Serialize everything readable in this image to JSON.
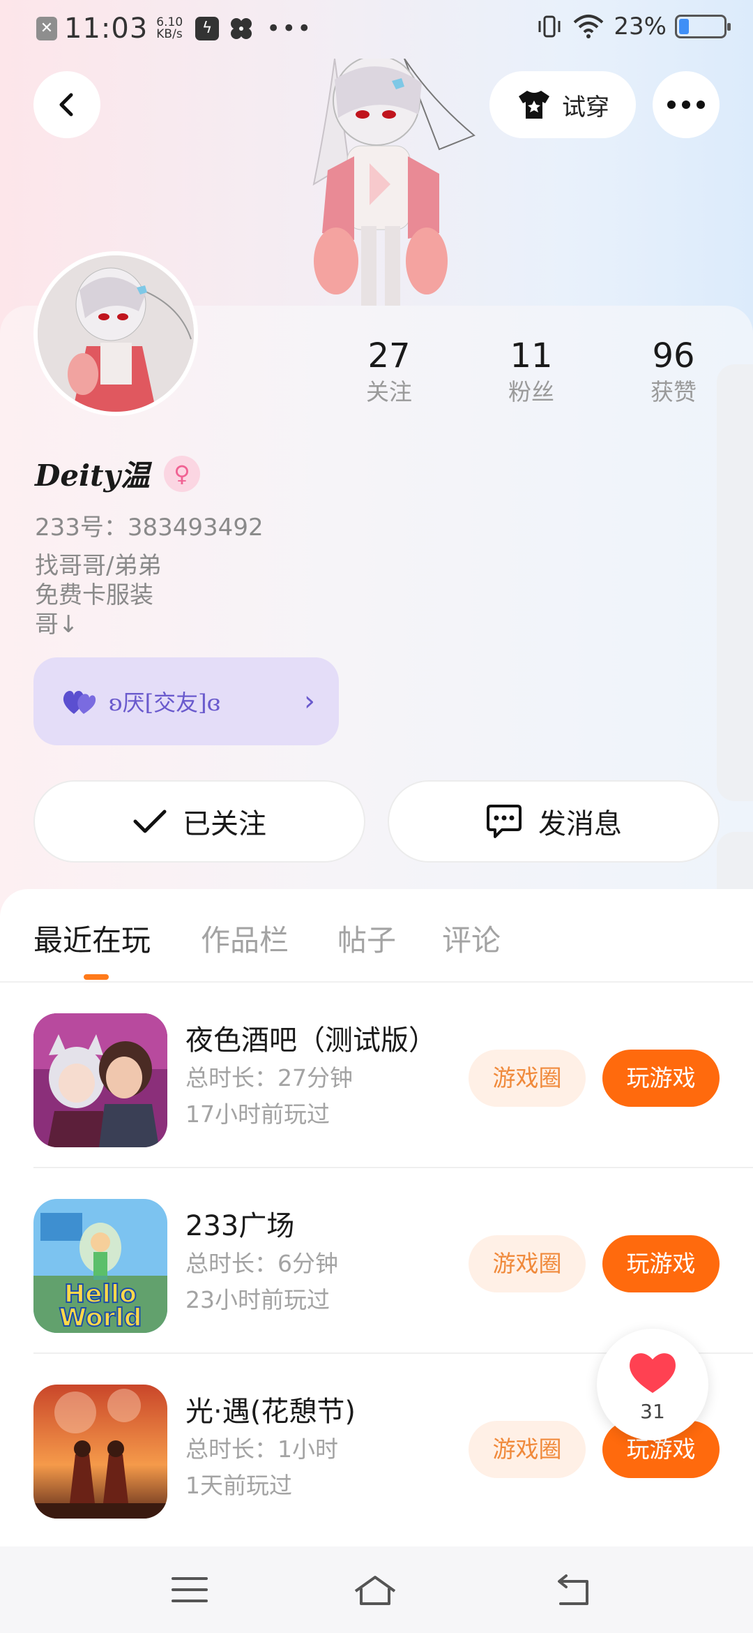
{
  "status_bar": {
    "time": "11:03",
    "speed_value": "6.10",
    "speed_unit": "KB/s",
    "battery_text": "23%",
    "battery_level": 0.23
  },
  "top": {
    "tryon_label": "试穿"
  },
  "profile": {
    "nickname": "Deity温",
    "gender_symbol": "♀",
    "uid": "233号：383493492",
    "bio": [
      "找哥哥/弟弟",
      "免费卡服装",
      "哥↓"
    ],
    "club": "ʚ厌[交友]ɞ",
    "stats": [
      {
        "value": "27",
        "label": "关注"
      },
      {
        "value": "11",
        "label": "粉丝"
      },
      {
        "value": "96",
        "label": "获赞"
      }
    ],
    "follow_label": "已关注",
    "message_label": "发消息"
  },
  "tabs": [
    "最近在玩",
    "作品栏",
    "帖子",
    "评论"
  ],
  "games": [
    {
      "title": "夜色酒吧（测试版）",
      "duration": "总时长：27分钟",
      "last_played": "17小时前玩过"
    },
    {
      "title": "233广场",
      "duration": "总时长：6分钟",
      "last_played": "23小时前玩过",
      "icon_text": [
        "Hello",
        "World"
      ]
    },
    {
      "title": "光·遇(花憩节)",
      "duration": "总时长：1小时",
      "last_played": "1天前玩过"
    }
  ],
  "game_buttons": {
    "circle_label": "游戏圈",
    "play_label": "玩游戏"
  },
  "like": {
    "count": "31"
  },
  "colors": {
    "accent": "#ff6a0d",
    "accent_light": "#fff0e6",
    "club_bg": "#e4ddf8",
    "club_text": "#6a5acd"
  }
}
